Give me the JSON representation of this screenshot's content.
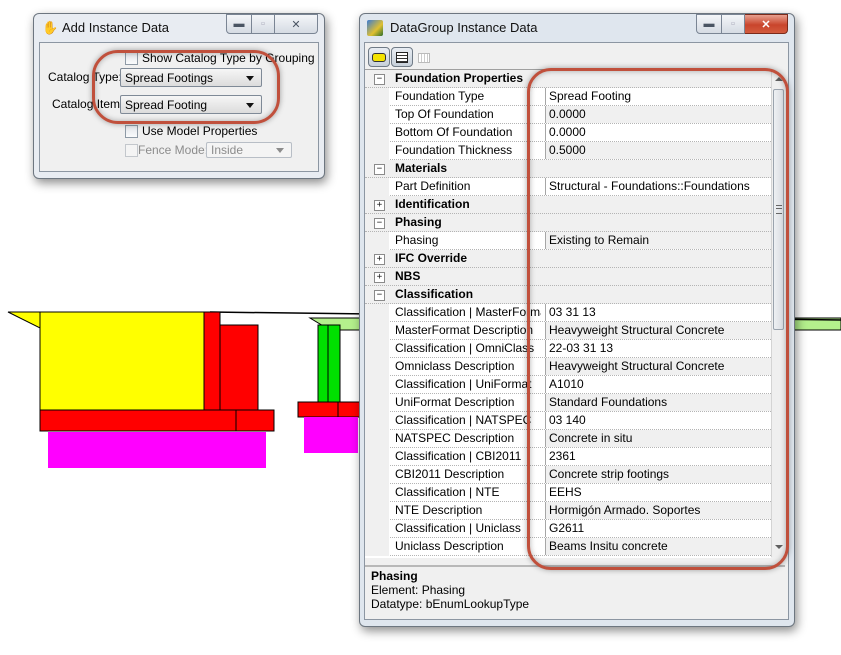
{
  "add_instance_dialog": {
    "title": "Add Instance Data",
    "icon": "tool-icon",
    "show_catalog_type_by_grouping": {
      "label": "Show Catalog Type by Grouping",
      "checked": false
    },
    "catalog_type": {
      "label": "Catalog Type:",
      "value": "Spread Footings"
    },
    "catalog_item": {
      "label": "Catalog Item:",
      "value": "Spread Footing"
    },
    "use_model_properties": {
      "label": "Use Model Properties",
      "checked": false
    },
    "fence_mode": {
      "label": "Fence Mode:",
      "value": "Inside",
      "enabled": false
    }
  },
  "datagroup_window": {
    "title": "DataGroup Instance Data",
    "toolbar": [
      {
        "name": "speech-bubble-icon",
        "active": true
      },
      {
        "name": "document-icon",
        "active": true
      },
      {
        "name": "grid-icon",
        "active": false
      }
    ],
    "rows": [
      {
        "type": "cat",
        "name": "Foundation Properties",
        "expanded": true,
        "toggle": "−"
      },
      {
        "type": "prop",
        "name": "Foundation Type",
        "value": "Spread Footing"
      },
      {
        "type": "prop",
        "name": "Top Of Foundation",
        "value": "0.0000"
      },
      {
        "type": "prop",
        "name": "Bottom Of Foundation",
        "value": "0.0000"
      },
      {
        "type": "prop",
        "name": "Foundation Thickness",
        "value": "0.5000"
      },
      {
        "type": "cat",
        "name": "Materials",
        "expanded": true,
        "toggle": "−"
      },
      {
        "type": "prop",
        "name": "Part Definition",
        "value": "Structural - Foundations::Foundations"
      },
      {
        "type": "cat",
        "name": "Identification",
        "expanded": false,
        "toggle": "+"
      },
      {
        "type": "cat",
        "name": "Phasing",
        "expanded": true,
        "toggle": "−"
      },
      {
        "type": "prop",
        "name": "Phasing",
        "value": "Existing to Remain"
      },
      {
        "type": "cat",
        "name": "IFC Override",
        "expanded": false,
        "toggle": "+"
      },
      {
        "type": "cat",
        "name": "NBS",
        "expanded": false,
        "toggle": "+"
      },
      {
        "type": "cat",
        "name": "Classification",
        "expanded": true,
        "toggle": "−"
      },
      {
        "type": "prop",
        "name": "Classification | MasterFormat",
        "value": "03 31 13"
      },
      {
        "type": "prop",
        "name": "MasterFormat Description",
        "value": "Heavyweight Structural Concrete"
      },
      {
        "type": "prop",
        "name": "Classification | OmniClass",
        "value": "22-03 31 13"
      },
      {
        "type": "prop",
        "name": "Omniclass Description",
        "value": "Heavyweight Structural Concrete"
      },
      {
        "type": "prop",
        "name": "Classification | UniFormat",
        "value": "A1010"
      },
      {
        "type": "prop",
        "name": "UniFormat Description",
        "value": "Standard Foundations"
      },
      {
        "type": "prop",
        "name": "Classification | NATSPEC",
        "value": "03 140"
      },
      {
        "type": "prop",
        "name": "NATSPEC Description",
        "value": "Concrete in situ"
      },
      {
        "type": "prop",
        "name": "Classification | CBI2011",
        "value": "2361"
      },
      {
        "type": "prop",
        "name": "CBI2011 Description",
        "value": "Concrete strip footings"
      },
      {
        "type": "prop",
        "name": "Classification | NTE",
        "value": "EEHS"
      },
      {
        "type": "prop",
        "name": "NTE Description",
        "value": "Hormigón Armado. Soportes"
      },
      {
        "type": "prop",
        "name": "Classification | Uniclass",
        "value": "G2611"
      },
      {
        "type": "prop",
        "name": "Uniclass Description",
        "value": "Beams Insitu concrete"
      }
    ],
    "description": {
      "title": "Phasing",
      "line1": "Element: Phasing",
      "line2": "Datatype: bEnumLookupType"
    }
  },
  "colors": {
    "callout": "#c0503c",
    "footing_magenta": "#ff00ff",
    "abutment_yellow": "#ffff00",
    "wall_red": "#ff0000",
    "pier_green": "#00e000",
    "deck_light_green": "#b4f08c"
  }
}
